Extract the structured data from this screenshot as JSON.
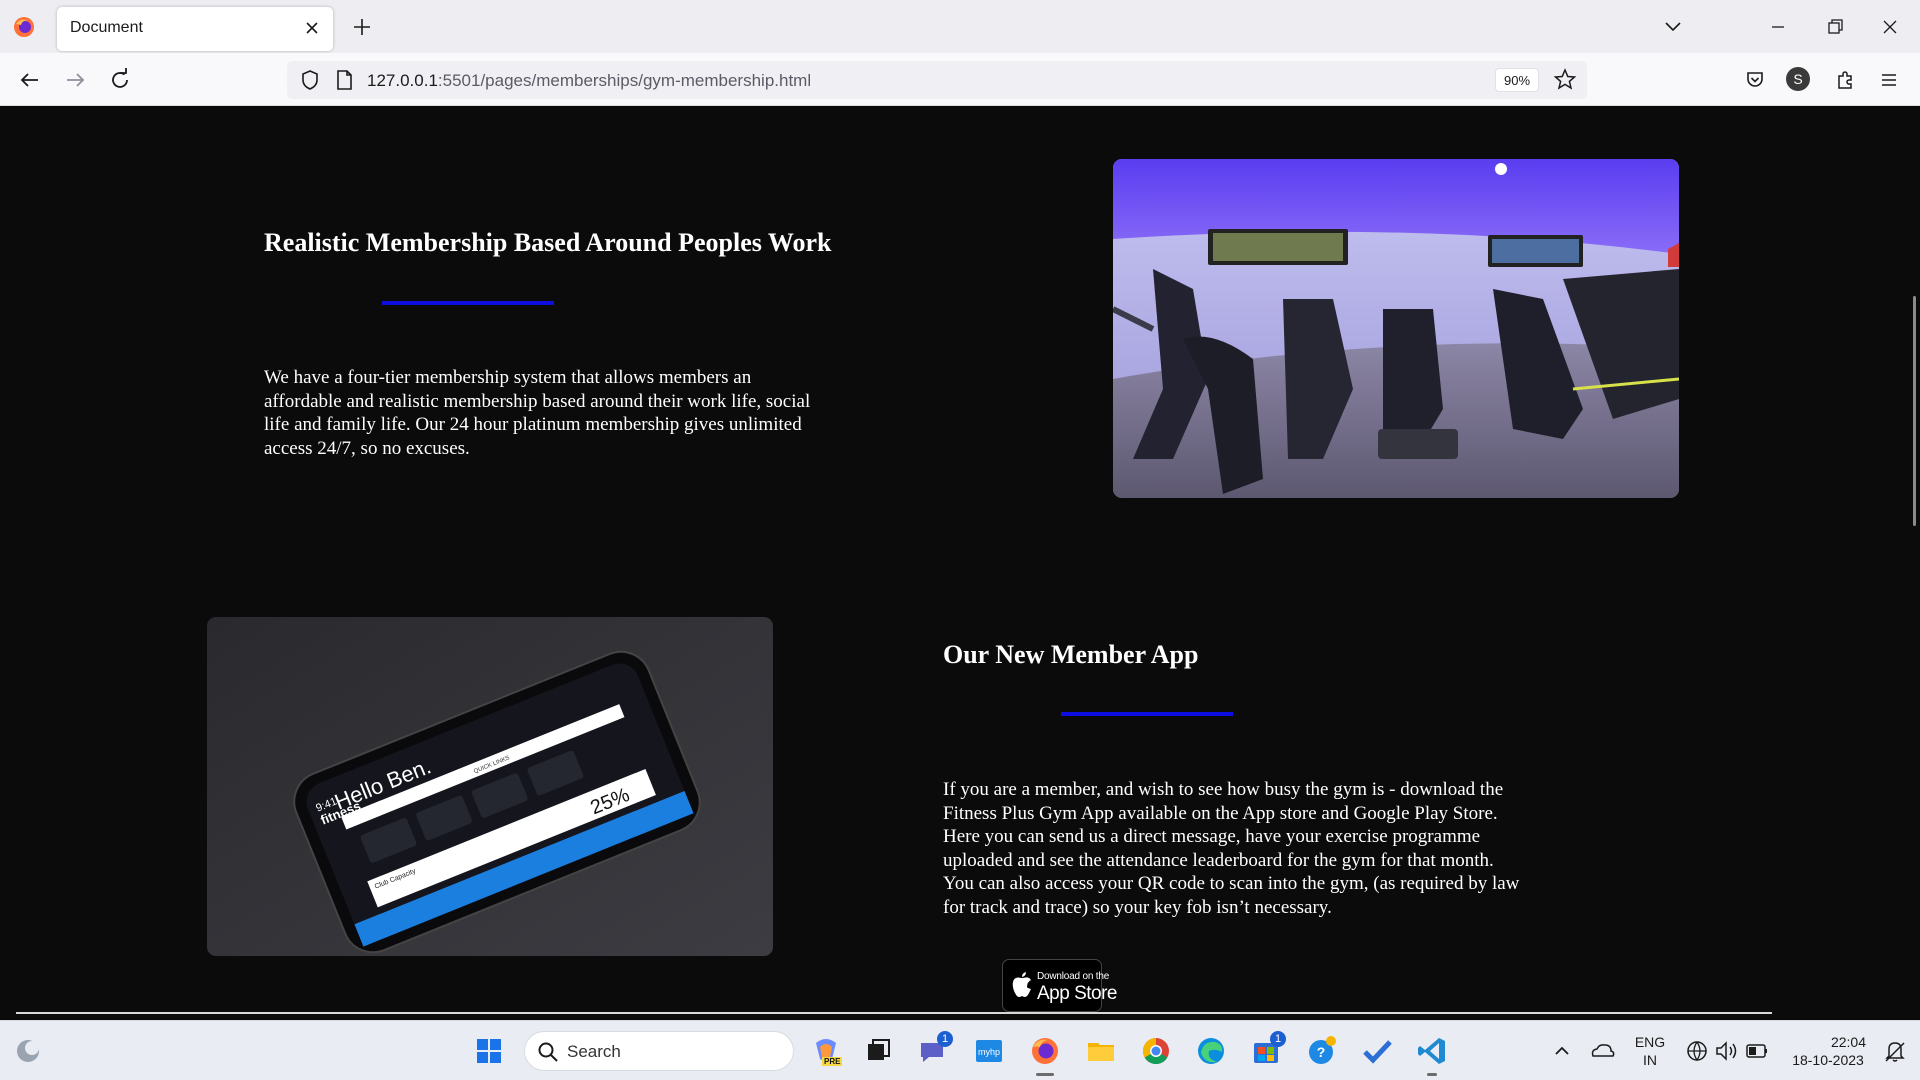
{
  "browser": {
    "tab_title": "Document",
    "url_host": "127.0.0.1",
    "url_rest": ":5501/pages/memberships/gym-membership.html",
    "zoom": "90%",
    "profile_initial": "S"
  },
  "page": {
    "section1": {
      "title": "Realistic Membership Based Around Peoples Work",
      "body": "We have a four-tier membership system that allows members an affordable and realistic membership based around their work life, social life and family life. Our 24 hour platinum membership gives unlimited access 24/7, so no excuses."
    },
    "section2": {
      "title": "Our New Member App",
      "body": "If you are a member, and wish to see how busy the gym is - download the Fitness Plus Gym App available on the App store and Google Play Store. Here you can send us a direct message, have your exercise programme uploaded and see the attendance leaderboard for the gym for that month. You can also access your QR code to scan into the gym, (as required by law for track and trace) so your key fob isn’t necessary.",
      "app_store_small": "Download on the",
      "app_store_big": "App Store"
    },
    "phone_screen": {
      "brand": "fitness",
      "time": "9:41",
      "greeting": "Hello Ben.",
      "quick_links": "QUICK LINKS",
      "capacity_label": "Club Capacity",
      "capacity_value": "25%"
    },
    "accent_color": "#0d0de0"
  },
  "taskbar": {
    "search_placeholder": "Search",
    "lang_top": "ENG",
    "lang_bottom": "IN",
    "time": "22:04",
    "date": "18-10-2023",
    "chat_badge": "1",
    "store_badge": "1",
    "copilot_label": "PRE"
  }
}
